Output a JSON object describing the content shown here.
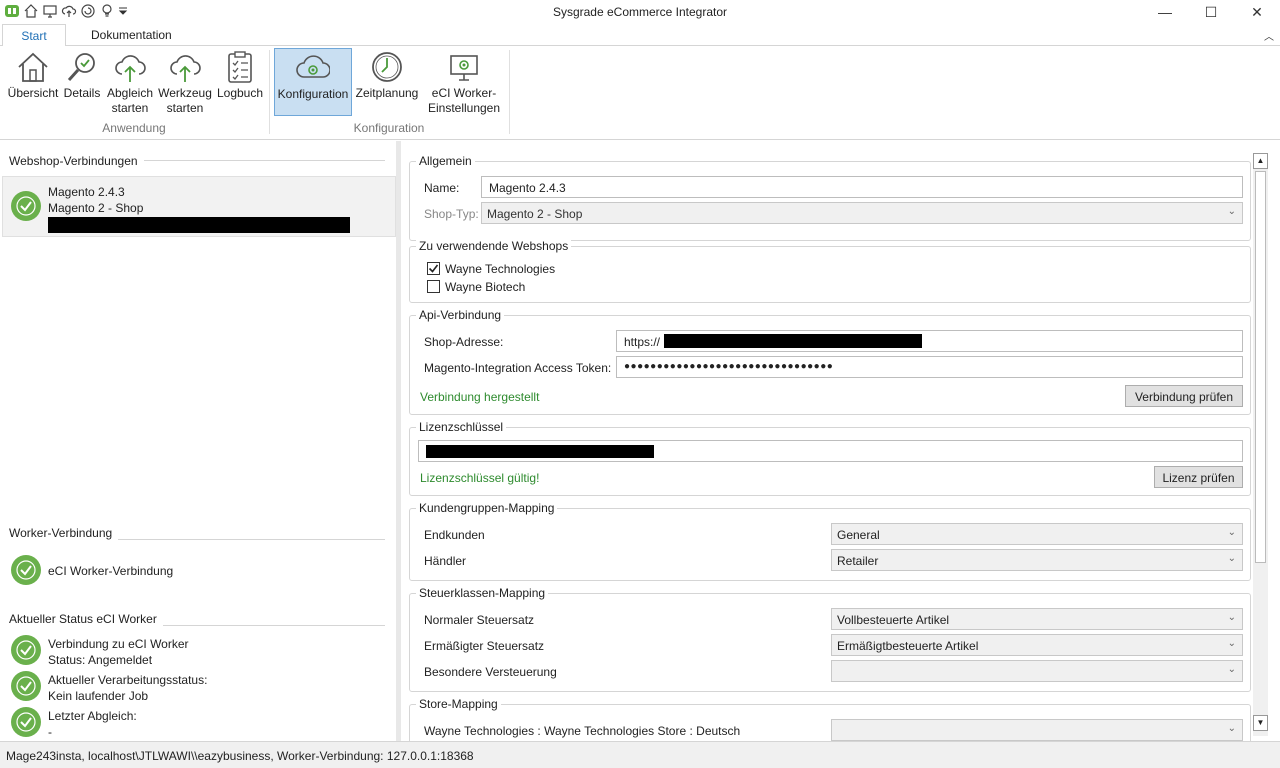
{
  "window": {
    "title": "Sysgrade eCommerce Integrator",
    "quick_access_icons": [
      "app-icon",
      "home-icon",
      "monitor-icon",
      "cloud-sync-icon",
      "refresh-icon",
      "lightbulb-icon",
      "dropdown-icon"
    ],
    "controls": {
      "minimize": "—",
      "maximize": "☐",
      "close": "✕"
    }
  },
  "tabs": [
    {
      "label": "Start",
      "active": true
    },
    {
      "label": "Dokumentation",
      "active": false
    }
  ],
  "ribbon": {
    "groups": [
      {
        "label": "Anwendung",
        "buttons": [
          {
            "label": "Übersicht",
            "icon": "house-icon"
          },
          {
            "label": "Details",
            "icon": "magnifier-check-icon"
          },
          {
            "label1": "Abgleich",
            "label2": "starten",
            "icon": "cloud-upload-icon"
          },
          {
            "label1": "Werkzeug",
            "label2": "starten",
            "icon": "cloud-upload-icon"
          },
          {
            "label": "Logbuch",
            "icon": "checklist-icon"
          }
        ]
      },
      {
        "label": "Konfiguration",
        "buttons": [
          {
            "label": "Konfiguration",
            "icon": "cloud-gear-icon",
            "selected": true
          },
          {
            "label": "Zeitplanung",
            "icon": "clock-icon"
          },
          {
            "label1": "eCI Worker-",
            "label2": "Einstellungen",
            "icon": "computer-gear-icon"
          }
        ]
      }
    ]
  },
  "left": {
    "webshop_title": "Webshop-Verbindungen",
    "connection": {
      "line1": "Magento 2.4.3",
      "line2": "Magento 2 - Shop"
    },
    "worker_title": "Worker-Verbindung",
    "worker_item": "eCI Worker-Verbindung",
    "status_title": "Aktueller Status eCI Worker",
    "status_items": [
      {
        "line1": "Verbindung zu eCI Worker",
        "line2": "Status: Angemeldet"
      },
      {
        "line1": "Aktueller Verarbeitungsstatus:",
        "line2": "Kein laufender Job"
      },
      {
        "line1": "Letzter Abgleich:",
        "line2": "-"
      }
    ]
  },
  "right": {
    "allgemein": {
      "title": "Allgemein",
      "name_label": "Name:",
      "name_value": "Magento 2.4.3",
      "shoptyp_label": "Shop-Typ:",
      "shoptyp_value": "Magento 2 - Shop"
    },
    "webshops": {
      "title": "Zu verwendende Webshops",
      "items": [
        {
          "label": "Wayne Technologies",
          "checked": true
        },
        {
          "label": "Wayne Biotech",
          "checked": false
        }
      ]
    },
    "api": {
      "title": "Api-Verbindung",
      "address_label": "Shop-Adresse:",
      "address_value": "https://",
      "token_label": "Magento-Integration Access Token:",
      "token_value": "●●●●●●●●●●●●●●●●●●●●●●●●●●●●●●●●",
      "status": "Verbindung hergestellt",
      "check_button": "Verbindung prüfen"
    },
    "lizenz": {
      "title": "Lizenzschlüssel",
      "status": "Lizenzschlüssel gültig!",
      "check_button": "Lizenz prüfen"
    },
    "kundengruppen": {
      "title": "Kundengruppen-Mapping",
      "rows": [
        {
          "label": "Endkunden",
          "value": "General"
        },
        {
          "label": "Händler",
          "value": "Retailer"
        }
      ]
    },
    "steuer": {
      "title": "Steuerklassen-Mapping",
      "rows": [
        {
          "label": "Normaler Steuersatz",
          "value": "Vollbesteuerte Artikel"
        },
        {
          "label": "Ermäßigter Steuersatz",
          "value": "Ermäßigtbesteuerte Artikel"
        },
        {
          "label": "Besondere Versteuerung",
          "value": ""
        }
      ]
    },
    "store": {
      "title": "Store-Mapping",
      "rows": [
        {
          "label": "Wayne Technologies : Wayne Technologies Store : Deutsch",
          "value": ""
        }
      ]
    }
  },
  "statusbar": {
    "text": "Mage243insta, localhost\\JTLWAWI\\\\eazybusiness, Worker-Verbindung: 127.0.0.1:18368"
  }
}
